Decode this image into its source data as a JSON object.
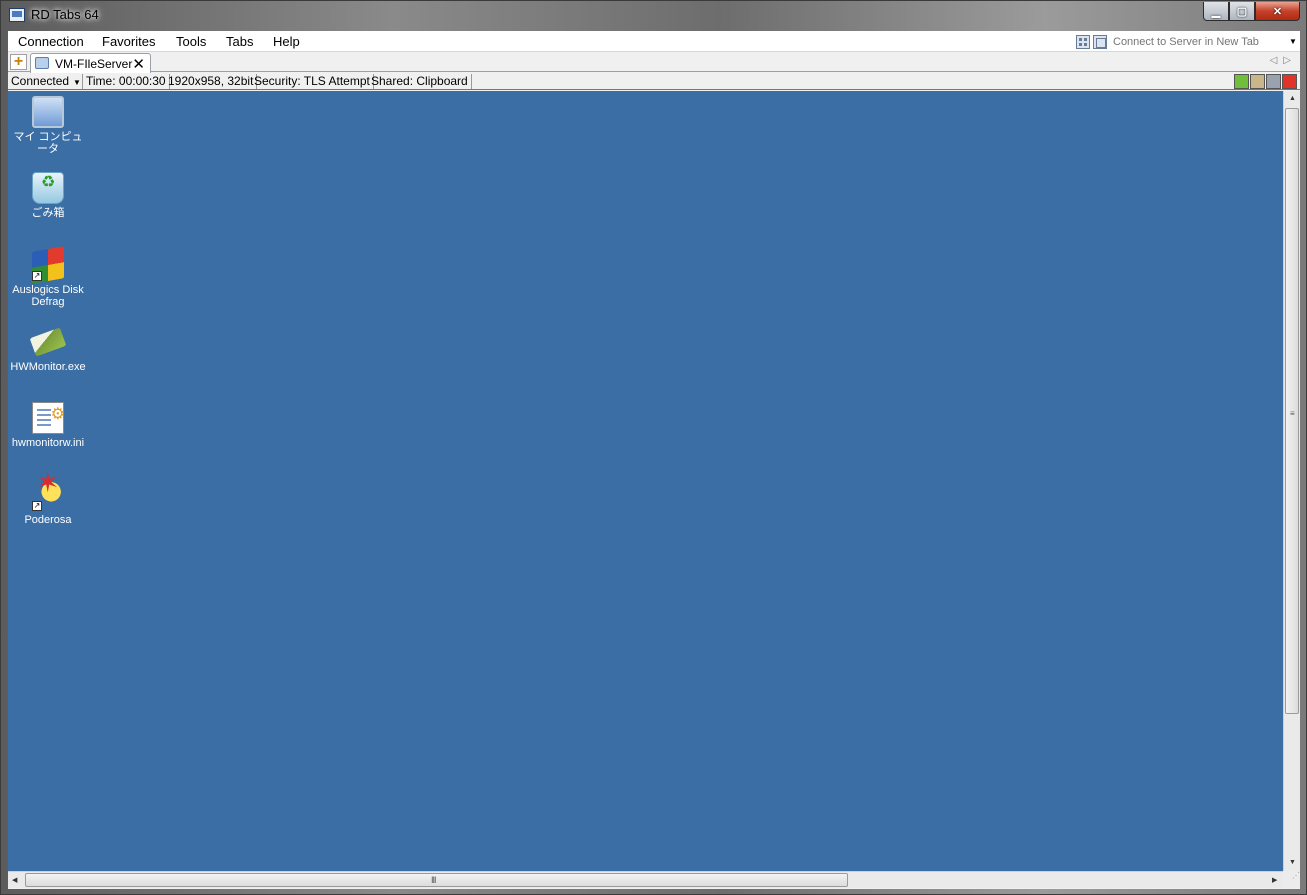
{
  "window": {
    "title": "RD Tabs 64",
    "caption_buttons": [
      "minimize-icon",
      "maximize-icon",
      "close-icon"
    ]
  },
  "menu": {
    "items": [
      {
        "label": "Connection"
      },
      {
        "label": "Favorites"
      },
      {
        "label": "Tools"
      },
      {
        "label": "Tabs"
      },
      {
        "label": "Help"
      }
    ]
  },
  "quick_connect": {
    "placeholder": "Connect to Server in New Tab"
  },
  "tabs": {
    "new_tab_icon": "plus-icon",
    "items": [
      {
        "label": "VM-FIleServer",
        "active": true
      }
    ]
  },
  "status": {
    "state": "Connected",
    "time": "Time: 00:00:30",
    "resolution": "1920x958, 32bit",
    "security": "Security: TLS Attempt",
    "shared": "Shared: Clipboard"
  },
  "desktop": {
    "background_color": "#3a6ea5",
    "icons": [
      {
        "label": "マイ コンピュータ",
        "icon": "computer-icon",
        "shortcut": false
      },
      {
        "label": "ごみ箱",
        "icon": "recycle-bin-icon",
        "shortcut": false
      },
      {
        "label": "Auslogics Disk Defrag",
        "icon": "disk-defrag-icon",
        "shortcut": true
      },
      {
        "label": "HWMonitor.exe",
        "icon": "hwmonitor-icon",
        "shortcut": false
      },
      {
        "label": "hwmonitorw.ini",
        "icon": "ini-file-icon",
        "shortcut": false
      },
      {
        "label": "Poderosa",
        "icon": "poderosa-icon",
        "shortcut": true
      }
    ]
  }
}
